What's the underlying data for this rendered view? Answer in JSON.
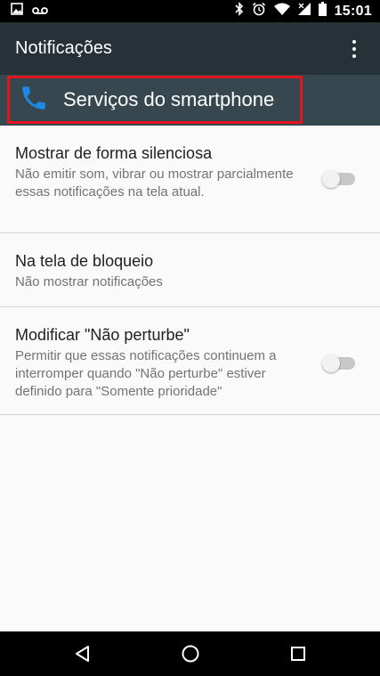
{
  "status_bar": {
    "time": "15:01",
    "left_icons": [
      "image-icon",
      "voicemail-icon"
    ],
    "right_icons": [
      "bluetooth-icon",
      "alarm-icon",
      "wifi-icon",
      "signal-icon",
      "battery-icon"
    ]
  },
  "app_bar": {
    "title": "Notificações",
    "menu_icon": "more-vert-icon"
  },
  "app_header": {
    "app_name": "Serviços do smartphone",
    "app_icon": "phone-icon",
    "icon_color": "#1e88e5",
    "highlight_color": "#e0151f"
  },
  "settings": [
    {
      "title": "Mostrar de forma silenciosa",
      "summary": "Não emitir som, vibrar ou mostrar parcialmente essas notificações na tela atual.",
      "toggle": false
    },
    {
      "title": "Na tela de bloqueio",
      "summary": "Não mostrar notificações"
    },
    {
      "title": "Modificar \"Não perturbe\"",
      "summary": "Permitir que essas notificações continuem a interromper quando \"Não perturbe\" estiver definido para \"Somente prioridade\"",
      "toggle": false
    }
  ],
  "nav_bar": {
    "buttons": [
      "back-icon",
      "home-icon",
      "recents-icon"
    ]
  }
}
